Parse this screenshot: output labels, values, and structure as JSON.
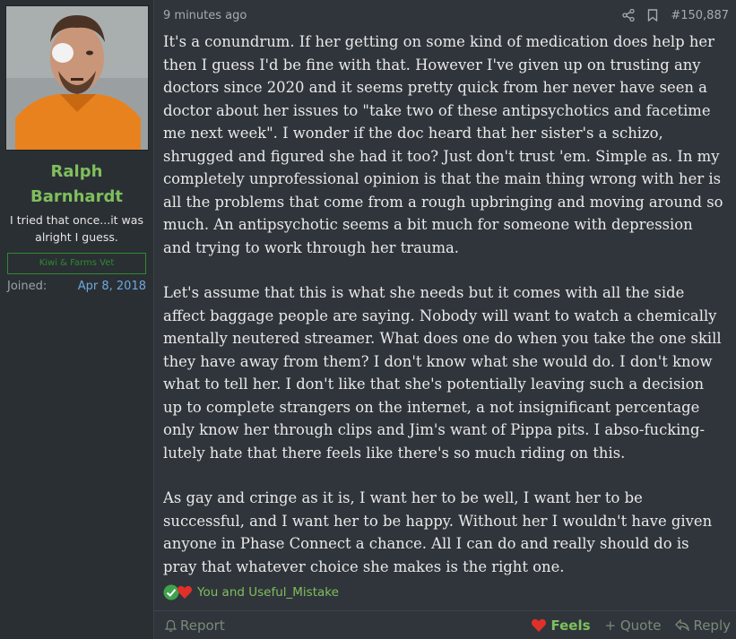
{
  "user": {
    "name_line1": "Ralph",
    "name_line2": "Barnhardt",
    "title": "I tried that once...it was alright I guess.",
    "banner": "Kiwi & Farms Vet",
    "joined_label": "Joined:",
    "joined_value": "Apr 8, 2018"
  },
  "post": {
    "time": "9 minutes ago",
    "number": "#150,887",
    "paragraphs": [
      "It's a conundrum. If her getting on some kind of medication does help her then I guess I'd be fine with that. However I've given up on trusting any doctors since 2020 and it seems pretty quick from her never have seen a doctor about her issues to \"take two of these antipsychotics and facetime me next week\". I wonder if the doc heard that her sister's a schizo, shrugged and figured she had it too? Just don't trust 'em. Simple as. In my completely unprofessional opinion is that the main thing wrong with her is all the problems that come from a rough upbringing and moving around so much. An antipsychotic seems a bit much for someone with depression and trying to work through her trauma.",
      "Let's assume that this is what she needs but it comes with all the side affect baggage people are saying. Nobody will want to watch a chemically mentally neutered streamer. What does one do when you take the one skill they have away from them? I don't know what she would do. I don't know what to tell her. I don't like that she's potentially leaving such a decision up to complete strangers on the internet, a not insignificant percentage only know her through clips and Jim's want of Pippa pits. I abso-fucking-lutely hate that there feels like there's so much riding on this.",
      "As gay and cringe as it is, I want her to be well, I want her to be successful, and I want her to be happy. Without her I wouldn't have given anyone in Phase Connect a chance. All I can do and really should do is pray that whatever choice she makes is the right one."
    ],
    "reactions_text": "You and Useful_Mistake"
  },
  "footer": {
    "report": "Report",
    "feels": "Feels",
    "quote": "+ Quote",
    "reply": "Reply"
  },
  "icons": {
    "share": "share-icon",
    "bookmark": "bookmark-icon",
    "check": "check-reaction-icon",
    "heart": "heart-icon",
    "bell": "report-icon",
    "reply": "reply-arrow-icon"
  },
  "colors": {
    "username": "#7fbf5d",
    "background": "#30353b",
    "sidebar": "#2a2f34",
    "heart": "#e0302a"
  }
}
